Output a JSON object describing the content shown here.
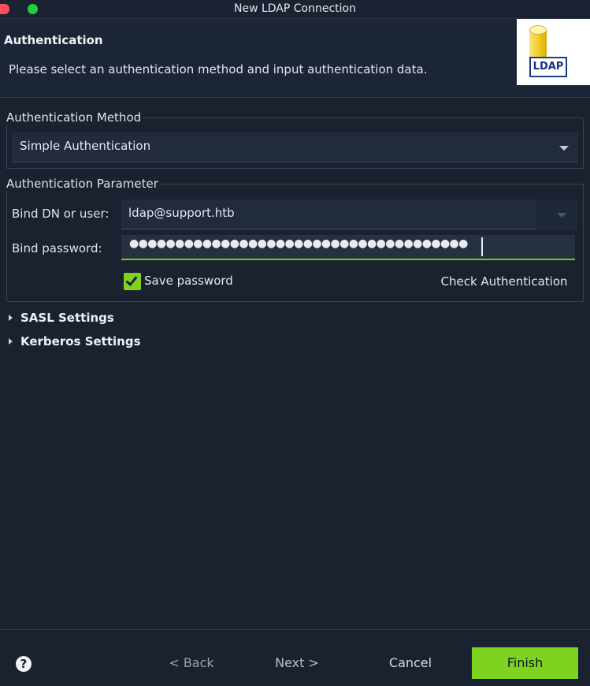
{
  "window": {
    "title": "New LDAP Connection"
  },
  "header": {
    "title": "Authentication",
    "description": "Please select an authentication method and input authentication data.",
    "logo_text": "LDAP"
  },
  "auth_method": {
    "legend": "Authentication Method",
    "selected": "Simple Authentication"
  },
  "auth_param": {
    "legend": "Authentication Parameter",
    "bind_label": "Bind DN or user:",
    "bind_value": "ldap@support.htb",
    "password_label": "Bind password:",
    "password_masked": "●●●●●●●●●●●●●●●●●●●●●●●●●●●●●●●●●●●●●",
    "save_password_label": "Save password",
    "save_password_checked": true,
    "check_auth_label": "Check Authentication"
  },
  "sections": {
    "sasl": "SASL Settings",
    "kerberos": "Kerberos Settings"
  },
  "footer": {
    "help_glyph": "?",
    "back_label": "< Back",
    "next_label": "Next >",
    "cancel_label": "Cancel",
    "finish_label": "Finish"
  },
  "colors": {
    "accent": "#7ed321",
    "background": "#1a2230"
  }
}
